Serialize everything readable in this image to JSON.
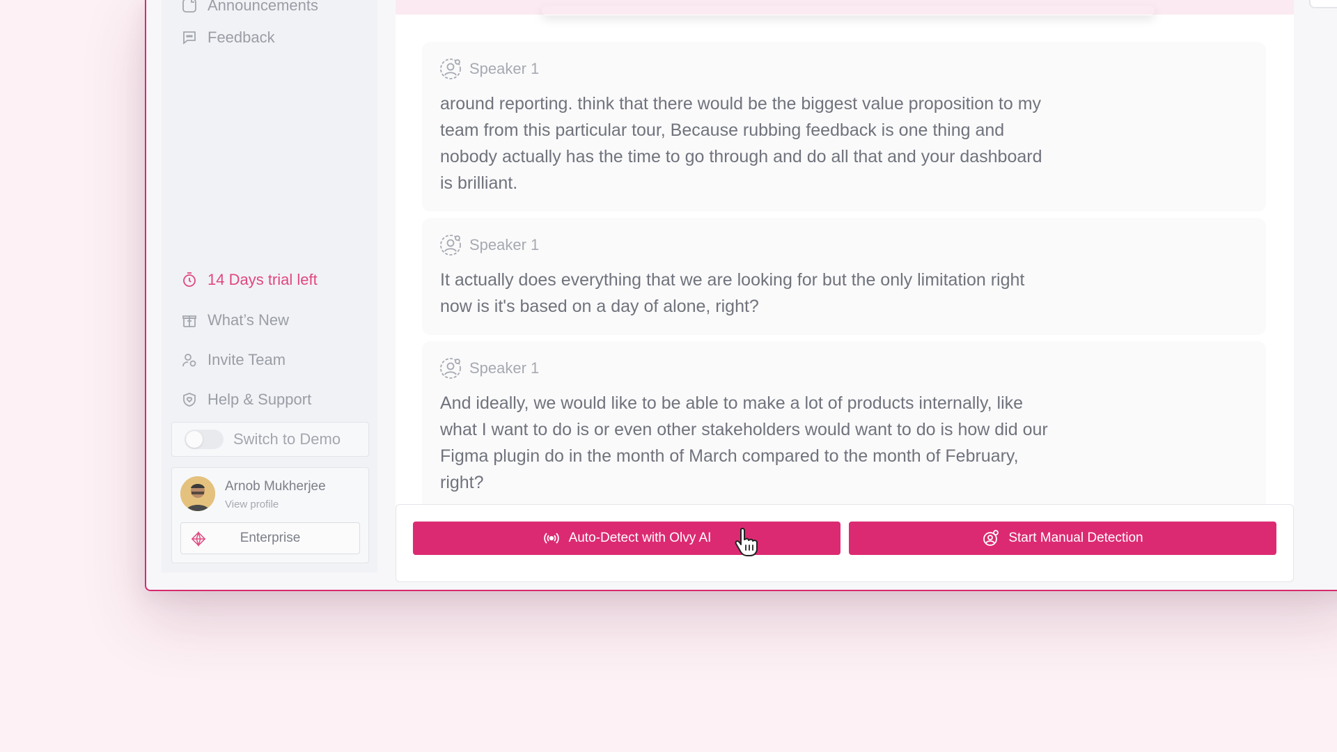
{
  "sidebar": {
    "top_items": [
      {
        "label": "Announcements",
        "icon": "announcement-icon"
      },
      {
        "label": "Feedback",
        "icon": "feedback-icon"
      }
    ],
    "bottom_items": [
      {
        "label": "14 Days trial left",
        "icon": "timer-icon"
      },
      {
        "label": "What’s New",
        "icon": "gift-icon"
      },
      {
        "label": "Invite Team",
        "icon": "user-add-icon"
      },
      {
        "label": "Help & Support",
        "icon": "shield-heart-icon"
      }
    ],
    "demo_toggle": {
      "label": "Switch to Demo",
      "on": false
    },
    "profile": {
      "name": "Arnob Mukherjee",
      "link": "View profile",
      "plan": "Enterprise"
    }
  },
  "transcript": [
    {
      "speaker": "Speaker 1",
      "text": "around reporting. think that there would be the biggest value proposition to my team from this particular tour, Because rubbing feedback is one thing and nobody actually has the time to go through and do all that and your dashboard is brilliant."
    },
    {
      "speaker": "Speaker 1",
      "text": "It actually does everything that we are looking for but the only limitation right now is it's based on a day of alone, right?"
    },
    {
      "speaker": "Speaker 1",
      "text": "And ideally, we would like to be able to make a lot of products internally, like what I want to do is or even other stakeholders would want to do is how did our Figma plugin do in the month of March compared to the month of February, right?"
    }
  ],
  "actions": {
    "auto_detect_label": "Auto-Detect with Olvy AI",
    "manual_label": "Start Manual Detection"
  },
  "colors": {
    "accent": "#dc2a72",
    "trial": "#e0477f",
    "background": "#fdf1f5"
  }
}
